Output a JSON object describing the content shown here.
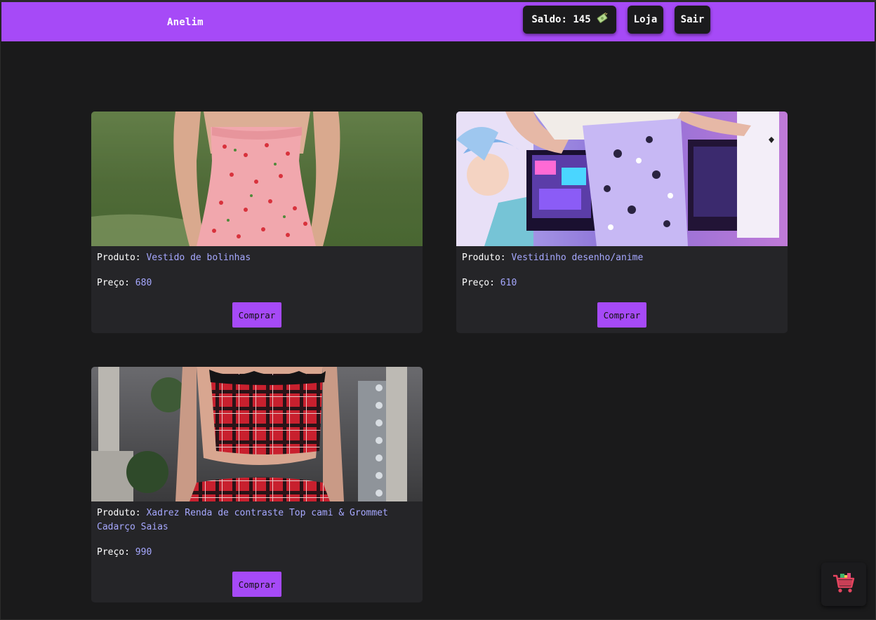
{
  "header": {
    "brand": "Anelim",
    "balance_label": "Saldo: 145",
    "coin_icon": "money-icon",
    "shop_label": "Loja",
    "logout_label": "Sair"
  },
  "products": [
    {
      "label": "Produto:",
      "name": "Vestido de bolinhas",
      "price_label": "Preço:",
      "price": "680",
      "button": "Comprar",
      "image": "pink-cherry-dress-photo"
    },
    {
      "label": "Produto:",
      "name": "Vestidinho desenho/anime",
      "price_label": "Preço:",
      "price": "610",
      "button": "Comprar",
      "image": "anime-print-dress-photo"
    },
    {
      "label": "Produto:",
      "name": "Xadrez Renda de contraste Top cami & Grommet Cadarço Saias",
      "price_label": "Preço:",
      "price": "990",
      "button": "Comprar",
      "image": "red-plaid-set-photo"
    }
  ],
  "cart": {
    "icon": "shopping-cart-icon"
  },
  "colors": {
    "accent": "#a64af7",
    "background": "#1a1a1b",
    "card": "#252528",
    "value_text": "#a6a8ff"
  }
}
